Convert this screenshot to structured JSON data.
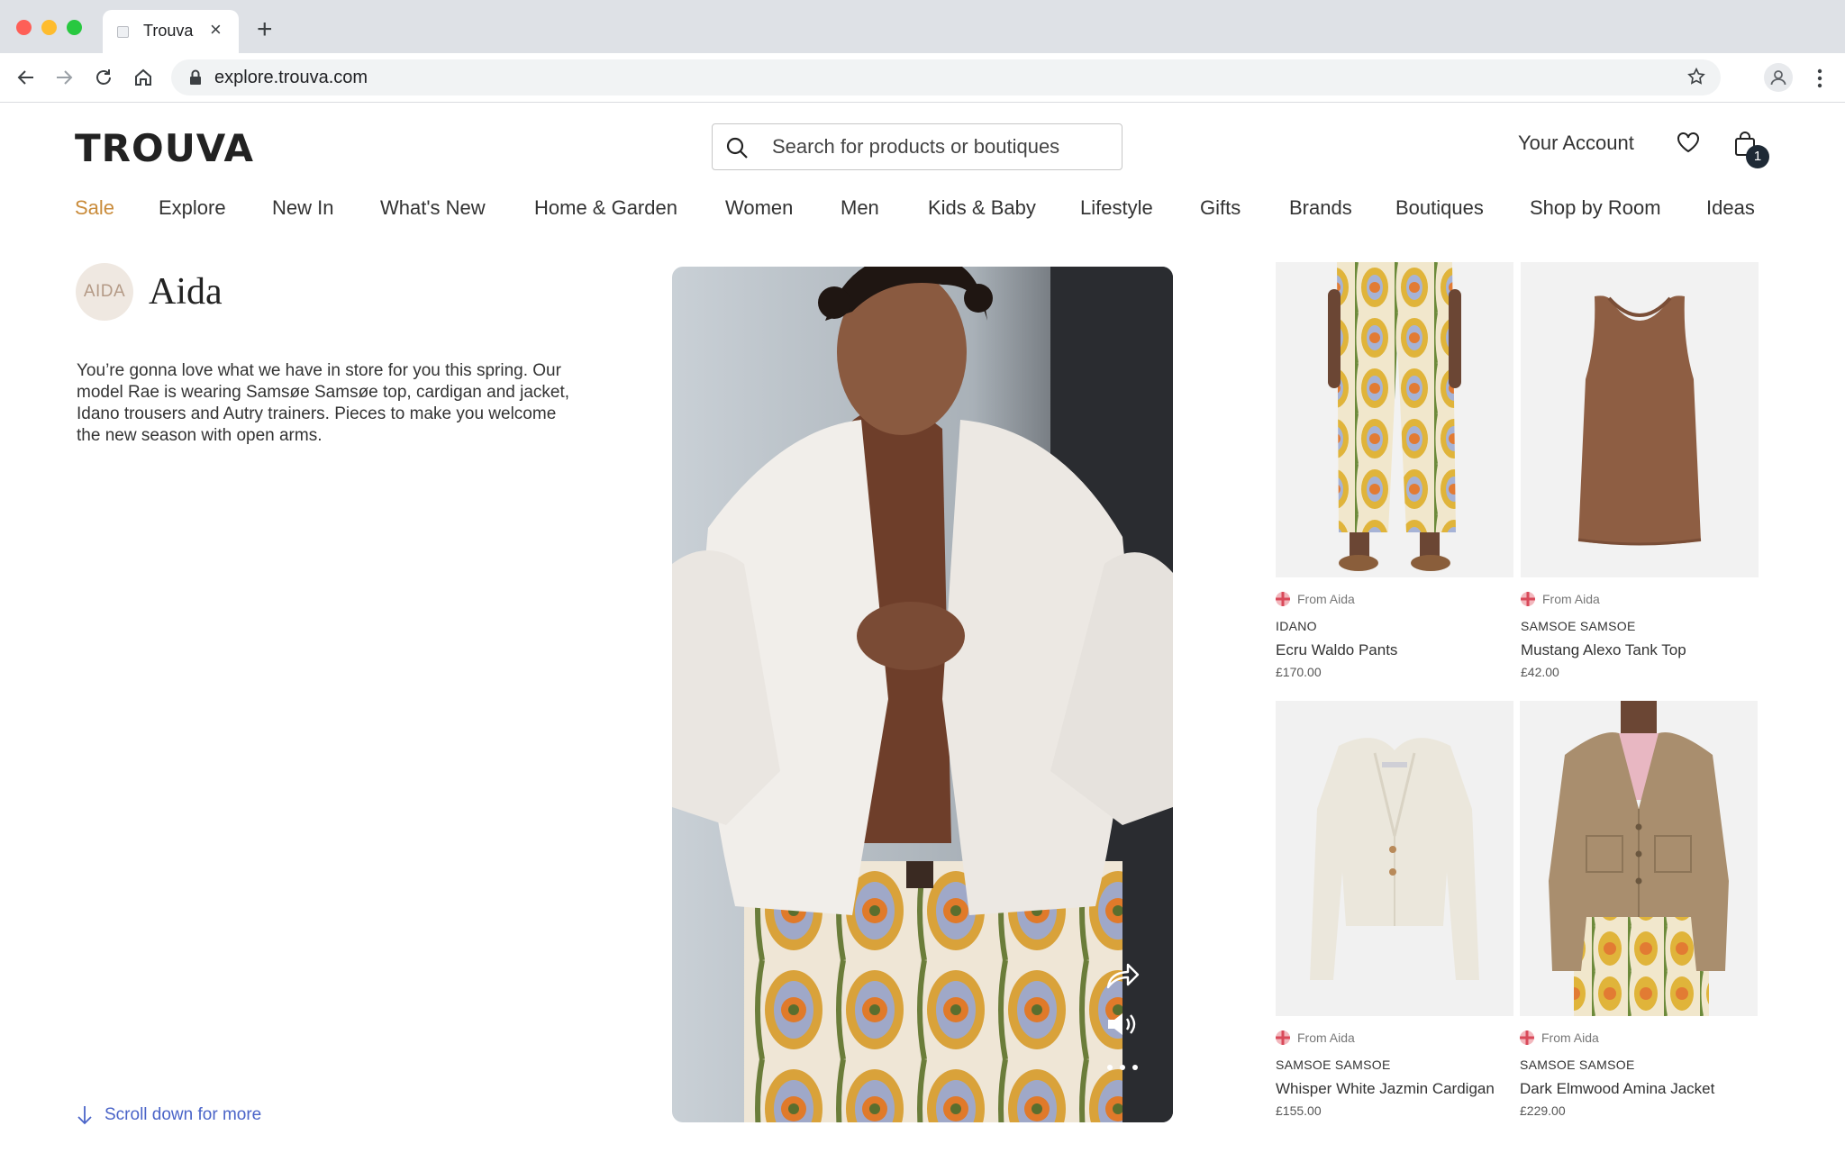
{
  "browser": {
    "tab_title": "Trouva",
    "url": "explore.trouva.com"
  },
  "header": {
    "logo": "TROUVA",
    "search_placeholder": "Search for products or boutiques",
    "account_label": "Your Account",
    "bag_count": "1"
  },
  "nav": {
    "items": [
      "Sale",
      "Explore",
      "New In",
      "What's New",
      "Home & Garden",
      "Women",
      "Men",
      "Kids & Baby",
      "Lifestyle",
      "Gifts",
      "Brands",
      "Boutiques",
      "Shop by Room",
      "Ideas"
    ]
  },
  "boutique": {
    "avatar_text": "AIDA",
    "name": "Aida",
    "description": "You’re gonna love what we have in store for you this spring. Our model Rae is wearing Samsøe Samsøe top, cardigan and jacket, Idano trousers and Autry trainers. Pieces to make you welcome the new season with open arms."
  },
  "scroll_hint": "Scroll down for more",
  "products": [
    {
      "from": "From Aida",
      "brand": "IDANO",
      "name": "Ecru Waldo Pants",
      "price": "£170.00"
    },
    {
      "from": "From Aida",
      "brand": "SAMSOE SAMSOE",
      "name": "Mustang Alexo Tank Top",
      "price": "£42.00"
    },
    {
      "from": "From Aida",
      "brand": "SAMSOE SAMSOE",
      "name": "Whisper White Jazmin Cardigan",
      "price": "£155.00"
    },
    {
      "from": "From Aida",
      "brand": "SAMSOE SAMSOE",
      "name": "Dark Elmwood Amina Jacket",
      "price": "£229.00"
    }
  ],
  "colors": {
    "sale_accent": "#c98b3a",
    "link_blue": "#4a64c8",
    "badge_bg": "#1f2a36"
  },
  "icons": [
    "back-icon",
    "forward-icon",
    "reload-icon",
    "home-icon",
    "lock-icon",
    "star-icon",
    "profile-icon",
    "menu-icon",
    "search-icon",
    "heart-icon",
    "bag-icon",
    "share-icon",
    "volume-icon",
    "more-icon",
    "arrow-down-icon",
    "uk-flag-icon"
  ]
}
